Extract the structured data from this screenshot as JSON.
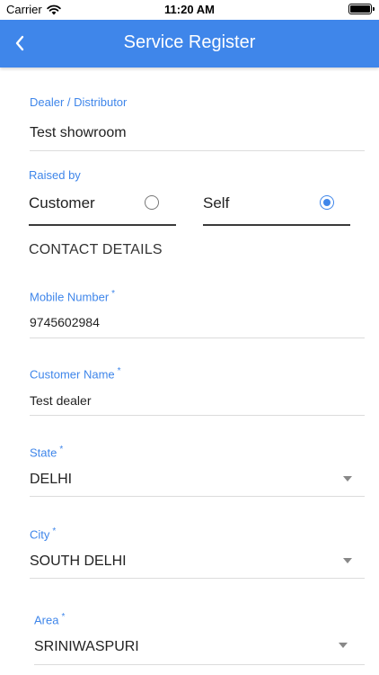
{
  "status_bar": {
    "carrier": "Carrier",
    "time": "11:20 AM"
  },
  "header": {
    "title": "Service Register",
    "back_icon": "chevron-left-icon"
  },
  "form": {
    "dealer": {
      "label": "Dealer / Distributor",
      "value": "Test showroom"
    },
    "raised_by": {
      "label": "Raised by",
      "options": [
        {
          "label": "Customer",
          "selected": false
        },
        {
          "label": "Self",
          "selected": true
        }
      ]
    },
    "contact_heading": "CONTACT DETAILS",
    "mobile": {
      "label": "Mobile Number",
      "required_mark": "*",
      "value": "9745602984"
    },
    "customer_name": {
      "label": "Customer Name",
      "required_mark": "*",
      "value": "Test dealer"
    },
    "state": {
      "label": "State",
      "required_mark": "*",
      "value": "DELHI"
    },
    "city": {
      "label": "City",
      "required_mark": "*",
      "value": "SOUTH DELHI"
    },
    "area": {
      "label": "Area",
      "required_mark": "*",
      "value": "SRINIWASPURI"
    }
  },
  "colors": {
    "accent": "#3f86ea",
    "divider": "#dcdcdc"
  }
}
